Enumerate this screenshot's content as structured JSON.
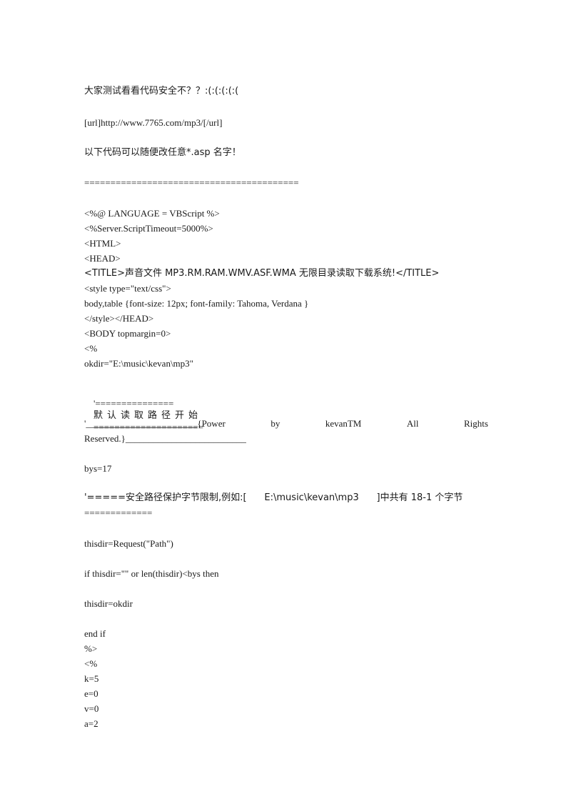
{
  "document": {
    "intro": {
      "question": "大家测试看看代码安全不？？:(:(:(:(:(",
      "url": "[url]http://www.7765.com/mp3/[/url]",
      "note": "以下代码可以随便改任意*.asp 名字！",
      "separator": "========================================="
    },
    "code_header": [
      "<%@ LANGUAGE = VBScript %>",
      "<%Server.ScriptTimeout=5000%>",
      "<HTML>",
      "<HEAD>",
      "<TITLE>声音文件 MP3.RM.RAM.WMV.ASF.WMA 无限目录读取下载系统!</TITLE>",
      "<style type=\"text/css\">",
      "body,table {font-size: 12px; font-family: Tahoma, Verdana }",
      "</style></HEAD>",
      "<BODY topmargin=0>",
      "<%",
      "okdir=\"E:\\music\\kevan\\mp3\""
    ],
    "default_path_comment": {
      "prefix": "'===============",
      "title": "默认读取路径开始",
      "suffix": "====================="
    },
    "credit_comment": {
      "line1_parts": [
        "'________________________{Power",
        "by",
        "kevanTM",
        "All",
        "Rights"
      ],
      "line2": "Reserved.}__________________________"
    },
    "bys_assign": "bys=17",
    "security_comment": {
      "line1": "'=====安全路径保护字节限制,例如:[      E:\\music\\kevan\\mp3      ]中共有 18-1 个字节",
      "line2": "============="
    },
    "code_body": {
      "request_path": "thisdir=Request(\"Path\")",
      "if_condition": "if thisdir=\"\" or len(thisdir)<bys then",
      "assign_okdir": "thisdir=okdir",
      "end_block": [
        "end if",
        "%>",
        "<%",
        "k=5",
        "e=0",
        "v=0",
        "a=2"
      ]
    }
  }
}
